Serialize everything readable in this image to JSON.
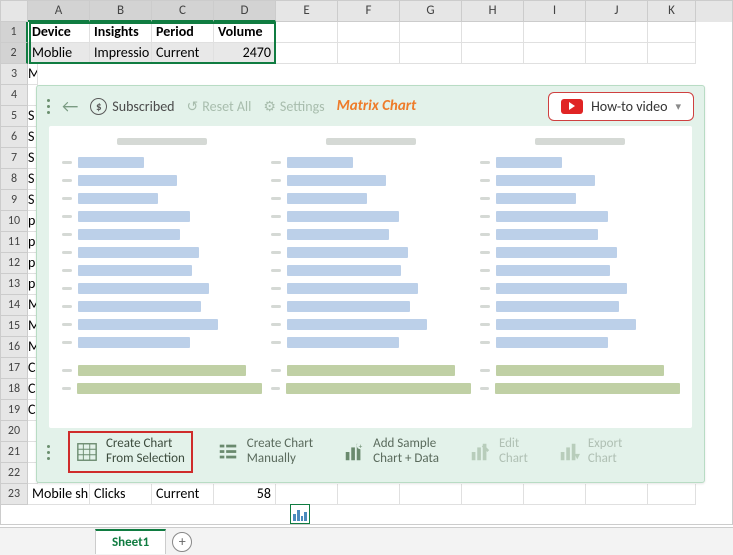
{
  "columns": [
    "A",
    "B",
    "C",
    "D",
    "E",
    "F",
    "G",
    "H",
    "I",
    "J",
    "K"
  ],
  "rows": [
    "1",
    "2",
    "3",
    "4",
    "5",
    "6",
    "7",
    "8",
    "9",
    "10",
    "11",
    "12",
    "13",
    "14",
    "15",
    "16",
    "17",
    "18",
    "19",
    "20",
    "21",
    "22",
    "23"
  ],
  "grid": {
    "headers": [
      "Device",
      "Insights",
      "Period",
      "Volume"
    ],
    "r2": [
      "Moblie",
      "Impressio",
      "Current",
      "2470"
    ],
    "r3_a": "M",
    "partial": [
      "S",
      "S",
      "S",
      "S",
      "S",
      "p",
      "p",
      "p",
      "p",
      "M",
      "M",
      "M",
      "C",
      "C",
      "C"
    ],
    "r23": {
      "a": "Mobile sh",
      "b": "Clicks",
      "c": "Current",
      "d": "58"
    }
  },
  "panel": {
    "subscribed": "Subscribed",
    "reset": "Reset All",
    "settings": "Settings",
    "title": "Matrix Chart",
    "video_btn": "How-to video",
    "actions": {
      "create_sel": {
        "l1": "Create Chart",
        "l2": "From Selection"
      },
      "create_man": {
        "l1": "Create Chart",
        "l2": "Manually"
      },
      "add_sample": {
        "l1": "Add Sample",
        "l2": "Chart + Data"
      },
      "edit": {
        "l1": "Edit",
        "l2": "Chart"
      },
      "export": {
        "l1": "Export",
        "l2": "Chart"
      }
    },
    "mini_bars": [
      70,
      105,
      85,
      118,
      108,
      128,
      120,
      138,
      130,
      148,
      118
    ],
    "green_bars": [
      172,
      192
    ]
  },
  "sheet_tab": "Sheet1",
  "chart_data": {
    "type": "bar",
    "note": "Three repeated horizontal-bar preview thumbnails; schematic placeholder, no real numeric axes shown",
    "series": [
      {
        "name": "blue",
        "values": [
          70,
          105,
          85,
          118,
          108,
          128,
          120,
          138,
          130,
          148,
          118
        ]
      },
      {
        "name": "green",
        "values": [
          172,
          192
        ]
      }
    ]
  }
}
